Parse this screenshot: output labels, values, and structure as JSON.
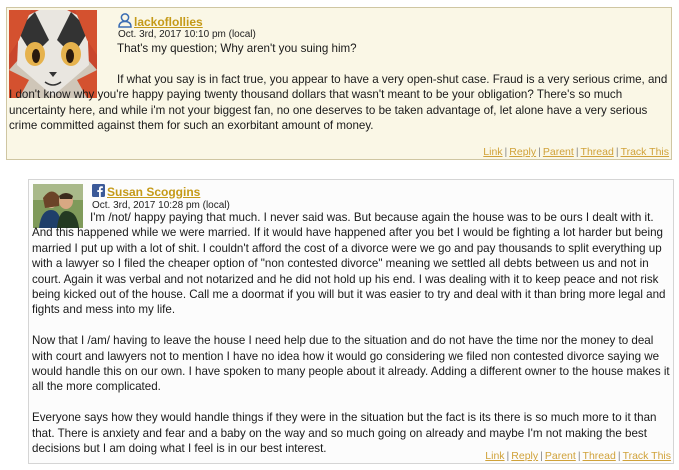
{
  "comments": [
    {
      "author": "lackoflollies",
      "author_icon": "user-icon",
      "date": "Oct. 3rd, 2017 10:10 pm (local)",
      "paragraphs": [
        "That's my question; Why aren't you suing him?",
        "If what you say is in fact true, you appear to have a very open-shut case. Fraud is a very serious crime, and I don't know why you're happy paying twenty thousand dollars that wasn't meant to be your obligation? There's so much uncertainty here, and while i'm not your biggest fan, no one deserves to be taken advantage of, let alone have a very serious crime committed against them for such an exorbitant amount of money."
      ],
      "actions": [
        "Link",
        "Reply",
        "Parent",
        "Thread",
        "Track This"
      ]
    },
    {
      "author": "Susan Scoggins",
      "author_icon": "facebook-icon",
      "date": "Oct. 3rd, 2017 10:28 pm (local)",
      "paragraphs": [
        "I'm /not/ happy paying that much. I never said was. But because again the house was to be ours I dealt with it. And this happened while we were married. If it would have happened after you bet I would be fighting a lot harder but being married I put up with a lot of shit. I couldn't afford the cost of a divorce were we go and pay thousands to split everything up with a lawyer so I filed the cheaper option of \"non contested divorce\" meaning we settled all debts between us and not in court. Again it was verbal and not notarized and he did not hold up his end. I was dealing with it to keep peace and not risk being kicked out of the house. Call me a doormat if you will but it was easier to try and deal with it than bring more legal and fights and mess into my life.",
        "Now that I /am/ having to leave the house I need help due to the situation and do not have the time nor the money to deal with court and lawyers not to mention I have no idea how it would go considering we filed non contested divorce saying we would handle this on our own. I have spoken to many people about it already. Adding a different owner to the house makes it all the more complicated.",
        "Everyone says how they would handle things if they were in the situation but the fact is its there is so much more to it than that. There is anxiety and fear and a baby on the way and so much going on already and maybe I'm not making the best decisions but I am doing what I feel is in our best interest."
      ],
      "actions": [
        "Link",
        "Reply",
        "Parent",
        "Thread",
        "Track This"
      ]
    }
  ],
  "colors": {
    "author_link": "#c59a18",
    "action_link": "#d0a23a",
    "comment1_bg": "#faf7e6",
    "comment2_bg": "#fcfcfc"
  }
}
